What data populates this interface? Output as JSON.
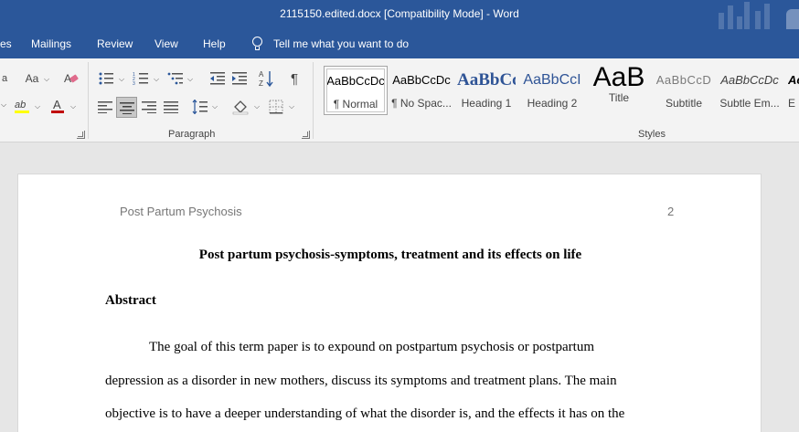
{
  "window": {
    "title": "2115150.edited.docx [Compatibility Mode]  -  Word"
  },
  "menu": {
    "tabs": [
      {
        "label": "es"
      },
      {
        "label": "Mailings"
      },
      {
        "label": "Review"
      },
      {
        "label": "View"
      },
      {
        "label": "Help"
      }
    ],
    "tell_me": "Tell me what you want to do"
  },
  "ribbon": {
    "font_group": {
      "change_case_label": "Aa",
      "highlight_label": "ab",
      "font_color_label": "A",
      "font_color": "#c00000"
    },
    "paragraph_group": {
      "label": "Paragraph",
      "sort_label": "A↓Z",
      "pilcrow": "¶"
    },
    "styles_group": {
      "label": "Styles",
      "items": [
        {
          "sample": "AaBbCcDc",
          "name": "¶ Normal",
          "selected": true
        },
        {
          "sample": "AaBbCcDc",
          "name": "¶ No Spac..."
        },
        {
          "sample": "AaBbCс",
          "name": "Heading 1",
          "color": "#2f5496"
        },
        {
          "sample": "AaBbCcI",
          "name": "Heading 2",
          "color": "#2f5496"
        },
        {
          "sample": "AaB",
          "name": "Title"
        },
        {
          "sample": "AaBbCcD",
          "name": "Subtitle",
          "color": "#595959"
        },
        {
          "sample": "AaBbCcDc",
          "name": "Subtle Em..."
        },
        {
          "sample": "Ac",
          "name": "E"
        }
      ]
    }
  },
  "document": {
    "header_left": "Post Partum Psychosis",
    "page_number": "2",
    "title": "Post partum psychosis-symptoms, treatment and its effects on life",
    "abstract_heading": "Abstract",
    "paragraph_lines": [
      "The goal of this term paper is to expound on postpartum psychosis or postpartum",
      "depression as a disorder in new mothers, discuss its symptoms and treatment plans. The main",
      "objective is to have a deeper understanding of what the disorder is, and the effects it has on the"
    ]
  }
}
